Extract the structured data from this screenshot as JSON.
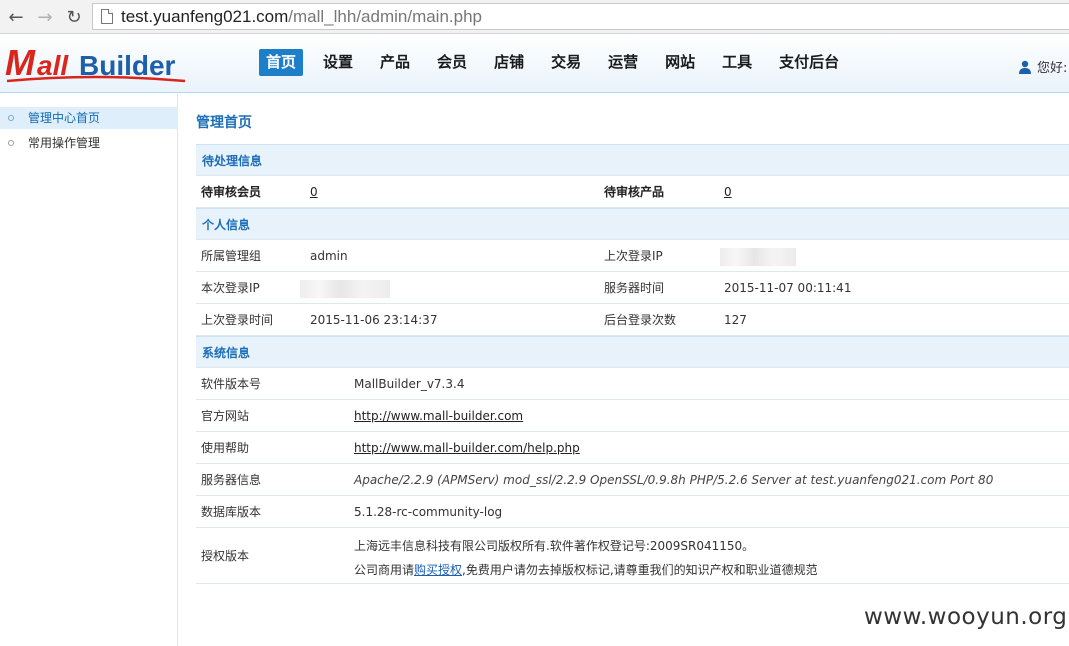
{
  "browser": {
    "url_host": "test.yuanfeng021.com",
    "url_path": "/mall_lhh/admin/main.php"
  },
  "header": {
    "logo_text_m": "M",
    "logo_text_all": "all",
    "logo_text_builder": "Builder",
    "nav": [
      "首页",
      "设置",
      "产品",
      "会员",
      "店铺",
      "交易",
      "运营",
      "网站",
      "工具",
      "支付后台"
    ],
    "active_nav_index": 0,
    "user_greeting": "您好:"
  },
  "sidebar": {
    "items": [
      {
        "label": "管理中心首页",
        "active": true
      },
      {
        "label": "常用操作管理",
        "active": false
      }
    ]
  },
  "main": {
    "title": "管理首页",
    "pending": {
      "heading": "待处理信息",
      "members_label": "待审核会员",
      "members_value": "0",
      "products_label": "待审核产品",
      "products_value": "0"
    },
    "personal": {
      "heading": "个人信息",
      "group_label": "所属管理组",
      "group_value": "admin",
      "last_ip_label": "上次登录IP",
      "current_ip_label": "本次登录IP",
      "server_time_label": "服务器时间",
      "server_time_value": "2015-11-07 00:11:41",
      "last_login_label": "上次登录时间",
      "last_login_value": "2015-11-06 23:14:37",
      "login_count_label": "后台登录次数",
      "login_count_value": "127"
    },
    "system": {
      "heading": "系统信息",
      "version_label": "软件版本号",
      "version_value": "MallBuilder_v7.3.4",
      "site_label": "官方网站",
      "site_value": "http://www.mall-builder.com",
      "help_label": "使用帮助",
      "help_value": "http://www.mall-builder.com/help.php",
      "server_label": "服务器信息",
      "server_value": "Apache/2.2.9 (APMServ) mod_ssl/2.2.9 OpenSSL/0.9.8h PHP/5.2.6 Server at test.yuanfeng021.com Port 80",
      "db_label": "数据库版本",
      "db_value": "5.1.28-rc-community-log",
      "license_label": "授权版本",
      "license_line1": "上海远丰信息科技有限公司版权所有.软件著作权登记号:2009SR041150。",
      "license_line2_pre": "公司商用请",
      "license_line2_link": "购买授权",
      "license_line2_post": ",免费用户请勿去掉版权标记,请尊重我们的知识产权和职业道德规范"
    }
  },
  "watermark": "www.wooyun.org",
  "colors": {
    "accent": "#1e7fc9",
    "section_bg": "#e8f2fb",
    "section_text": "#1e6fb8",
    "logo_red": "#d9251c",
    "logo_blue": "#1d5fa8"
  }
}
